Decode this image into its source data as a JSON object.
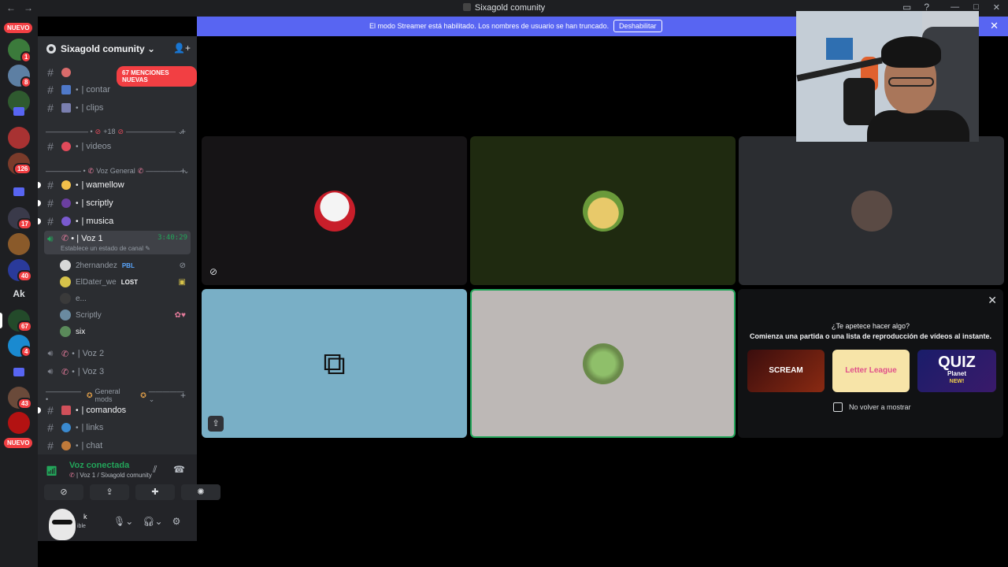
{
  "window": {
    "title": "Sixagold comunity"
  },
  "rail": {
    "new_label": "NUEVO",
    "badges": [
      "1",
      "8",
      "126",
      "17",
      "40",
      "67",
      "4",
      "43"
    ],
    "ak_label": "Ak"
  },
  "server": {
    "name": "Sixagold comunity",
    "mentions": "67 MENCIONES NUEVAS"
  },
  "categories": {
    "plus18": "+18",
    "voz_general": "Voz General",
    "general_mods": "General mods"
  },
  "channels": {
    "contar": "| contar",
    "clips": "| clips",
    "videos": "| videos",
    "wamellow": "| wamellow",
    "scriptly": "| scriptly",
    "musica": "| musica",
    "voz1": "| Voz 1",
    "voz1_time": "3:40:29",
    "voz1_status": "Establece un estado de canal",
    "voz2": "| Voz 2",
    "voz3": "| Voz 3",
    "comandos": "| comandos",
    "links": "| links",
    "chat": "| chat"
  },
  "voice_users": [
    {
      "name": "2hernandez",
      "tag": "PBL"
    },
    {
      "name": "ElDater_we",
      "tag": "LOST"
    },
    {
      "name": "e...",
      "tag": ""
    },
    {
      "name": "Scriptly",
      "tag": ""
    },
    {
      "name": "six",
      "tag": ""
    }
  ],
  "voice_panel": {
    "connected": "Voz conectada",
    "location": "| Voz 1 / Sixagold comunity",
    "user_suffix": "k",
    "user_status": "ible"
  },
  "banner": {
    "message": "El modo Streamer está habilitado. Los nombres de usuario se han truncado.",
    "disable": "Deshabilitar"
  },
  "activity": {
    "question": "¿Te apetece hacer algo?",
    "subtitle": "Comienza una partida o una lista de reproducción de vídeos al instante.",
    "games": [
      "SCREAM",
      "Letter League",
      "QUIZ",
      "Planet",
      "NEW!"
    ],
    "dont_show": "No volver a mostrar"
  },
  "colors": {
    "blurple": "#5865f2",
    "green": "#23a55a",
    "red": "#f23f43"
  }
}
